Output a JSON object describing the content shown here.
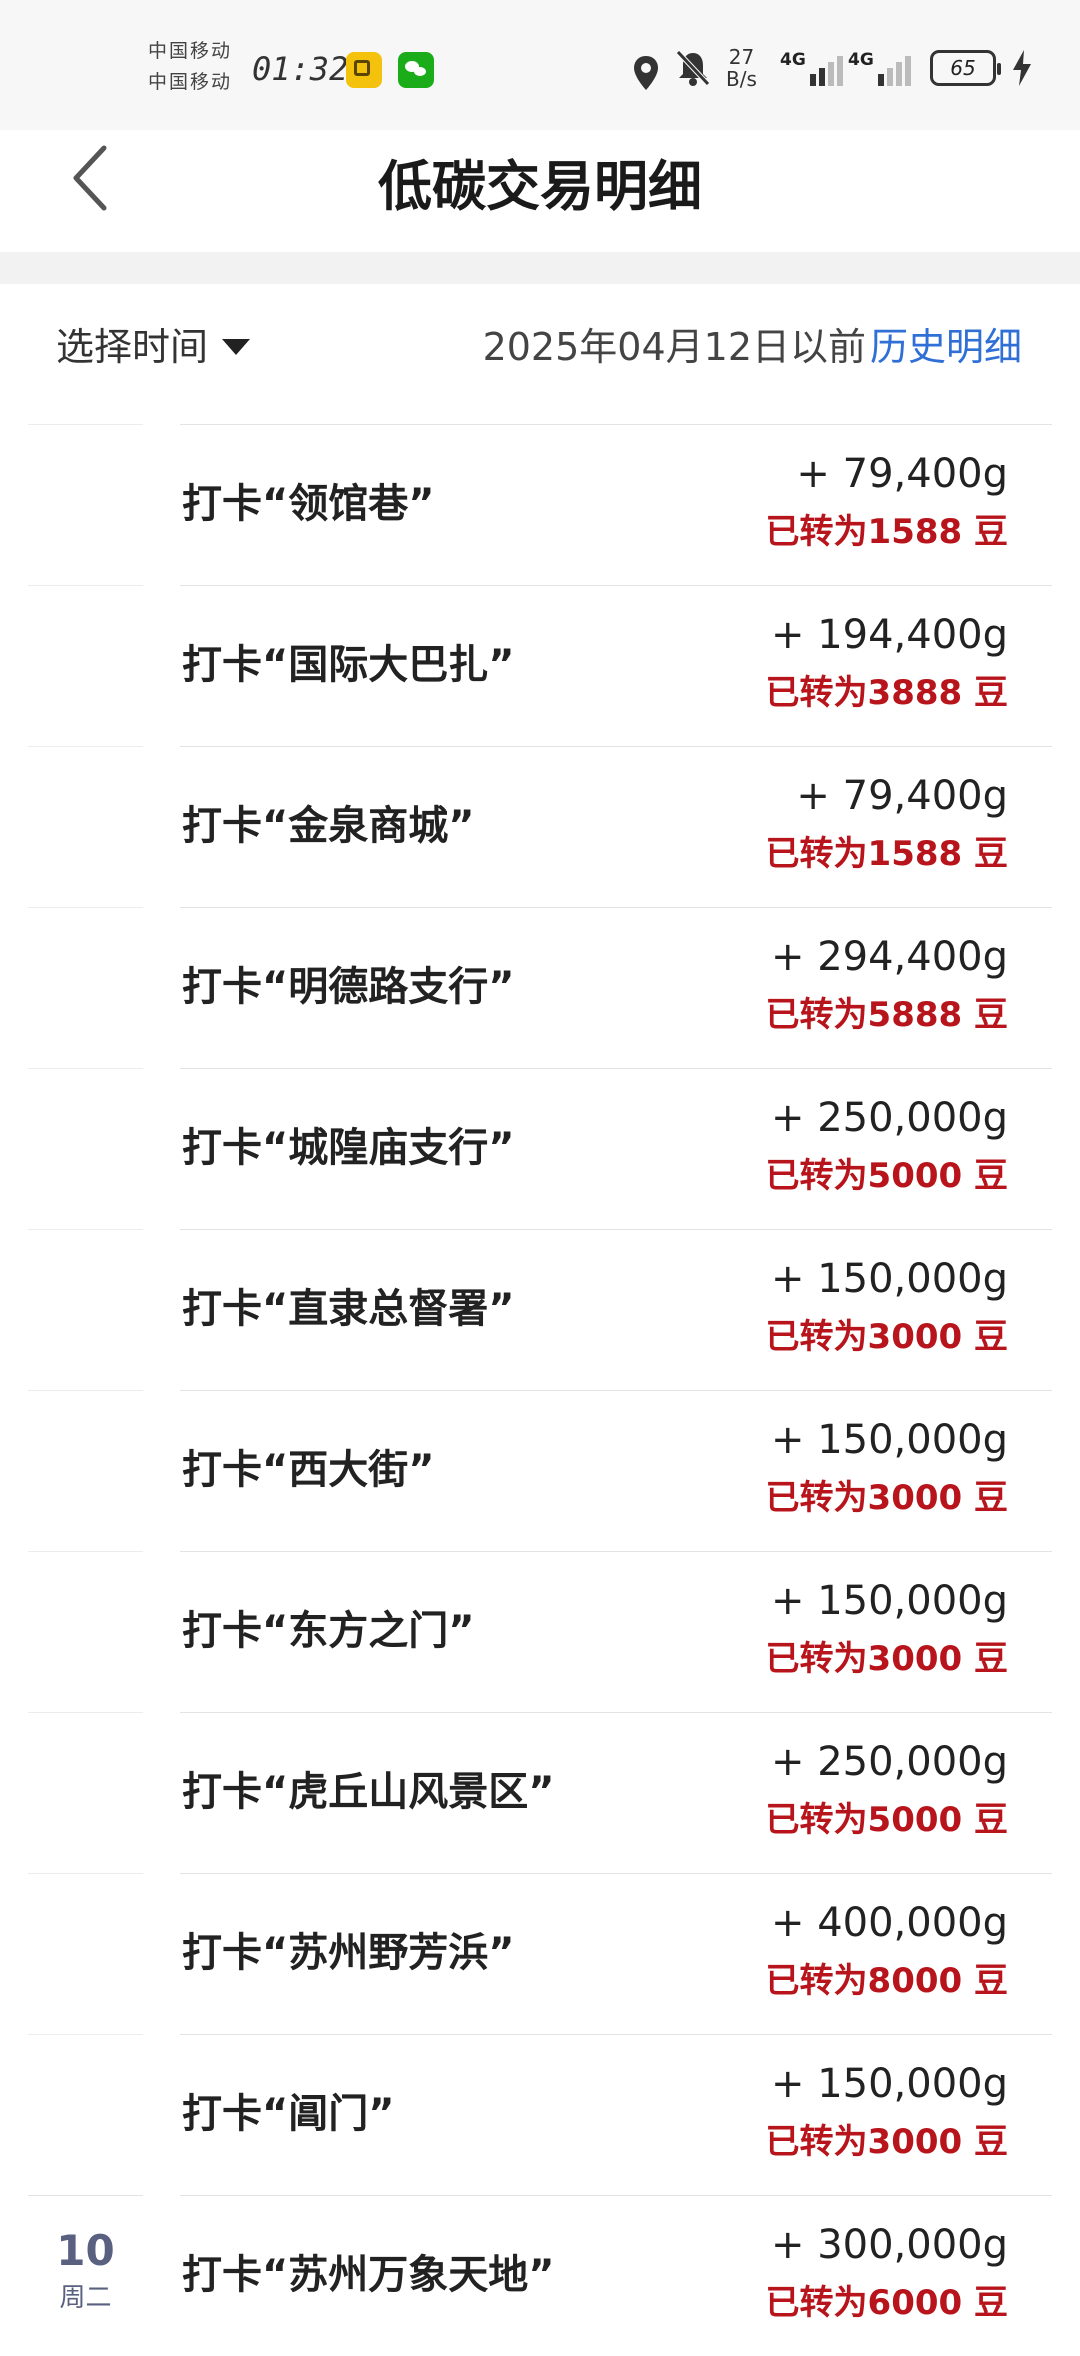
{
  "status_bar": {
    "carrier_1": "中国移动",
    "carrier_2": "中国移动",
    "time": "01:32",
    "net_speed_value": "27",
    "net_speed_unit": "B/s",
    "sim1_label": "4G",
    "sim2_label": "4G",
    "battery": "65"
  },
  "header": {
    "title": "低碳交易明细"
  },
  "filter": {
    "select_time_label": "选择时间",
    "date_hint": "2025年04月12日以前",
    "history_link": "历史明细"
  },
  "colors": {
    "accent_blue": "#2f6fd6",
    "converted_red": "#b8141b"
  },
  "transactions": [
    {
      "title": "打卡“领馆巷”",
      "amount": "+ 79,400g",
      "converted": "已转为1588 豆"
    },
    {
      "title": "打卡“国际大巴扎”",
      "amount": "+ 194,400g",
      "converted": "已转为3888 豆"
    },
    {
      "title": "打卡“金泉商城”",
      "amount": "+ 79,400g",
      "converted": "已转为1588 豆"
    },
    {
      "title": "打卡“明德路支行”",
      "amount": "+ 294,400g",
      "converted": "已转为5888 豆"
    },
    {
      "title": "打卡“城隍庙支行”",
      "amount": "+ 250,000g",
      "converted": "已转为5000 豆"
    },
    {
      "title": "打卡“直隶总督署”",
      "amount": "+ 150,000g",
      "converted": "已转为3000 豆"
    },
    {
      "title": "打卡“西大街”",
      "amount": "+ 150,000g",
      "converted": "已转为3000 豆"
    },
    {
      "title": "打卡“东方之门”",
      "amount": "+ 150,000g",
      "converted": "已转为3000 豆"
    },
    {
      "title": "打卡“虎丘山风景区”",
      "amount": "+ 250,000g",
      "converted": "已转为5000 豆"
    },
    {
      "title": "打卡“苏州野芳浜”",
      "amount": "+ 400,000g",
      "converted": "已转为8000 豆"
    },
    {
      "title": "打卡“阊门”",
      "amount": "+ 150,000g",
      "converted": "已转为3000 豆"
    },
    {
      "title": "打卡“苏州万象天地”",
      "amount": "+ 300,000g",
      "converted": "已转为6000 豆",
      "day": "10",
      "weekday": "周二"
    }
  ]
}
